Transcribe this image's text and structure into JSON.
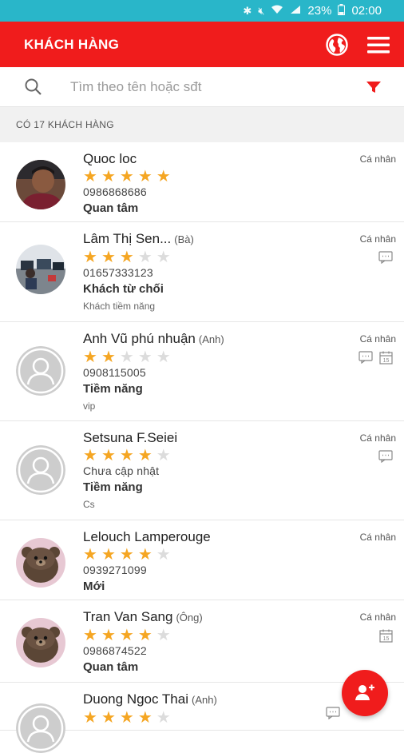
{
  "status_bar": {
    "battery": "23%",
    "time": "02:00"
  },
  "header": {
    "title": "KHÁCH HÀNG"
  },
  "search": {
    "placeholder": "Tìm theo tên hoặc sđt"
  },
  "list_count": "CÓ 17 KHÁCH HÀNG",
  "colors": {
    "primary": "#f01c1c",
    "status_bar": "#29b6c9",
    "star": "#f5a623"
  },
  "customers": [
    {
      "name": "Quoc loc",
      "honorific": "",
      "rating": 5,
      "phone": "0986868686",
      "status": "Quan tâm",
      "note": "",
      "type": "Cá nhân",
      "icons": [],
      "avatar": "photo-man"
    },
    {
      "name": "Lâm Thị Sen...",
      "honorific": "(Bà)",
      "rating": 3,
      "phone": "01657333123",
      "status": "Khách từ chối",
      "note": "Khách tiềm năng",
      "type": "Cá nhân",
      "icons": [
        "message-icon"
      ],
      "avatar": "photo-office"
    },
    {
      "name": "Anh Vũ phú nhuận",
      "honorific": "(Anh)",
      "rating": 2,
      "phone": "0908115005",
      "status": "Tiềm năng",
      "note": "vip",
      "type": "Cá nhân",
      "icons": [
        "message-icon",
        "calendar-icon"
      ],
      "avatar": "placeholder"
    },
    {
      "name": "Setsuna F.Seiei",
      "honorific": "",
      "rating": 4,
      "phone": "Chưa cập nhật",
      "status": "Tiềm năng",
      "note": "Cs",
      "type": "Cá nhân",
      "icons": [
        "message-icon"
      ],
      "avatar": "placeholder"
    },
    {
      "name": "Lelouch Lamperouge",
      "honorific": "",
      "rating": 4,
      "phone": "0939271099",
      "status": "Mới",
      "note": "",
      "type": "Cá nhân",
      "icons": [],
      "avatar": "bear"
    },
    {
      "name": "Tran Van Sang",
      "honorific": "(Ông)",
      "rating": 4,
      "phone": "0986874522",
      "status": "Quan tâm",
      "note": "",
      "type": "Cá nhân",
      "icons": [
        "calendar-icon"
      ],
      "avatar": "bear"
    },
    {
      "name": "Duong Ngoc Thai",
      "honorific": "(Anh)",
      "rating": 4,
      "phone": "",
      "status": "",
      "note": "",
      "type": "",
      "icons": [
        "message-icon"
      ],
      "avatar": "placeholder"
    }
  ]
}
